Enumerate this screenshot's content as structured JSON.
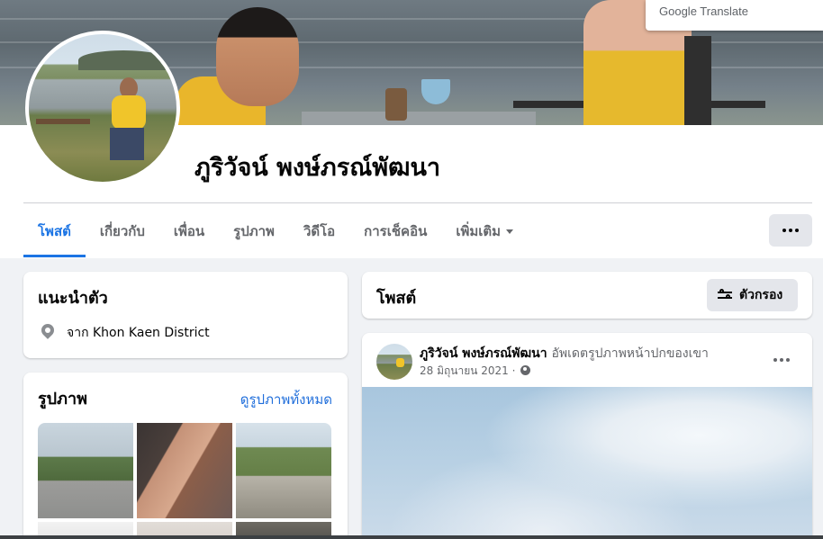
{
  "translate_popup": {
    "label": "Google Translate"
  },
  "profile": {
    "name": "ภูริวัจน์ พงษ์ภรณ์พัฒนา"
  },
  "tabs": [
    {
      "label": "โพสต์",
      "active": true
    },
    {
      "label": "เกี่ยวกับ",
      "active": false
    },
    {
      "label": "เพื่อน",
      "active": false
    },
    {
      "label": "รูปภาพ",
      "active": false
    },
    {
      "label": "วิดีโอ",
      "active": false
    },
    {
      "label": "การเช็คอิน",
      "active": false
    },
    {
      "label": "เพิ่มเติม",
      "active": false
    }
  ],
  "intro": {
    "title": "แนะนำตัว",
    "location_text": "จาก Khon Kaen District"
  },
  "photos": {
    "title": "รูปภาพ",
    "see_all": "ดูรูปภาพทั้งหมด"
  },
  "posts": {
    "title": "โพสต์",
    "filter_label": "ตัวกรอง"
  },
  "post": {
    "author": "ภูริวัจน์ พงษ์ภรณ์พัฒนา",
    "action": "อัพเดตรูปภาพหน้าปกของเขา",
    "date": "28 มิถุนายน 2021",
    "separator": "·"
  },
  "colors": {
    "accent": "#1b74e4",
    "link": "#216fdb",
    "background": "#f0f2f5",
    "secondary_text": "#65676b"
  }
}
